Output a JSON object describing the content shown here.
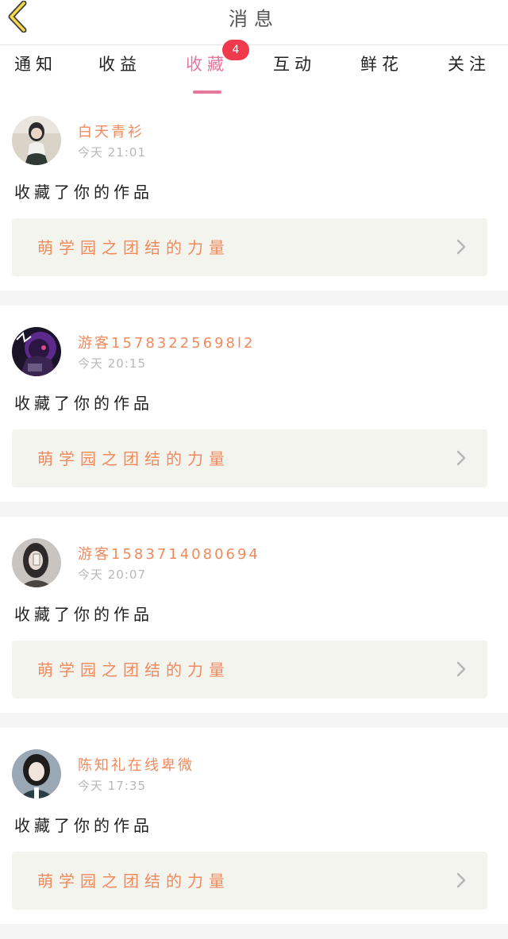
{
  "header": {
    "title": "消息",
    "back_icon": "chevron-left-icon"
  },
  "tabs": [
    {
      "label": "通知",
      "active": false
    },
    {
      "label": "收益",
      "active": false
    },
    {
      "label": "收藏",
      "active": true,
      "badge": "4"
    },
    {
      "label": "互动",
      "active": false
    },
    {
      "label": "鲜花",
      "active": false
    },
    {
      "label": "关注",
      "active": false
    }
  ],
  "colors": {
    "accent": "#e5789a",
    "badge": "#ef3a4e",
    "username": "#f08a5d",
    "work_box_bg": "#f4f4ef"
  },
  "messages": [
    {
      "username": "白天青衫",
      "time": "今天 21:01",
      "action": "收藏了你的作品",
      "work_title": "萌学园之团结的力量",
      "avatar_icon": "user-avatar-icon"
    },
    {
      "username": "游客15783225698l2",
      "time": "今天 20:15",
      "action": "收藏了你的作品",
      "work_title": "萌学园之团结的力量",
      "avatar_icon": "user-avatar-icon"
    },
    {
      "username": "游客1583714080694",
      "time": "今天 20:07",
      "action": "收藏了你的作品",
      "work_title": "萌学园之团结的力量",
      "avatar_icon": "user-avatar-icon"
    },
    {
      "username": "陈知礼在线卑微",
      "time": "今天 17:35",
      "action": "收藏了你的作品",
      "work_title": "萌学园之团结的力量",
      "avatar_icon": "user-avatar-icon"
    }
  ]
}
